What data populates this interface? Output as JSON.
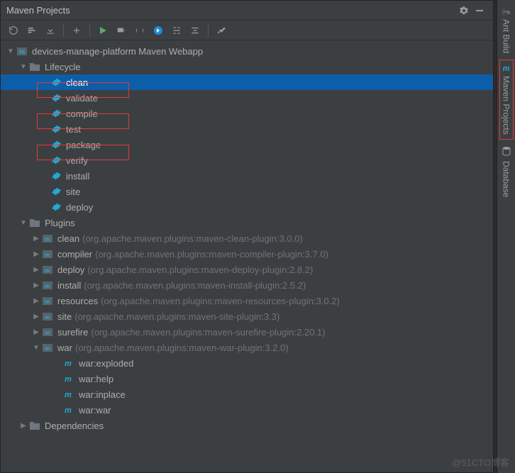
{
  "panel": {
    "title": "Maven Projects"
  },
  "rightTabs": {
    "ant": "Ant Build",
    "maven": "Maven Projects",
    "db": "Database"
  },
  "tree": {
    "project": "devices-manage-platform Maven Webapp",
    "lifecycle": {
      "label": "Lifecycle",
      "goals": [
        "clean",
        "validate",
        "compile",
        "test",
        "package",
        "verify",
        "install",
        "site",
        "deploy"
      ]
    },
    "plugins": {
      "label": "Plugins",
      "items": [
        {
          "name": "clean",
          "detail": "(org.apache.maven.plugins:maven-clean-plugin:3.0.0)",
          "expanded": false
        },
        {
          "name": "compiler",
          "detail": "(org.apache.maven.plugins:maven-compiler-plugin:3.7.0)",
          "expanded": false
        },
        {
          "name": "deploy",
          "detail": "(org.apache.maven.plugins:maven-deploy-plugin:2.8.2)",
          "expanded": false
        },
        {
          "name": "install",
          "detail": "(org.apache.maven.plugins:maven-install-plugin:2.5.2)",
          "expanded": false
        },
        {
          "name": "resources",
          "detail": "(org.apache.maven.plugins:maven-resources-plugin:3.0.2)",
          "expanded": false
        },
        {
          "name": "site",
          "detail": "(org.apache.maven.plugins:maven-site-plugin:3.3)",
          "expanded": false
        },
        {
          "name": "surefire",
          "detail": "(org.apache.maven.plugins:maven-surefire-plugin:2.20.1)",
          "expanded": false
        },
        {
          "name": "war",
          "detail": "(org.apache.maven.plugins:maven-war-plugin:3.2.0)",
          "expanded": true,
          "goals": [
            "war:exploded",
            "war:help",
            "war:inplace",
            "war:war"
          ]
        }
      ]
    },
    "dependencies": {
      "label": "Dependencies"
    }
  },
  "watermark": "@51CTO博客"
}
